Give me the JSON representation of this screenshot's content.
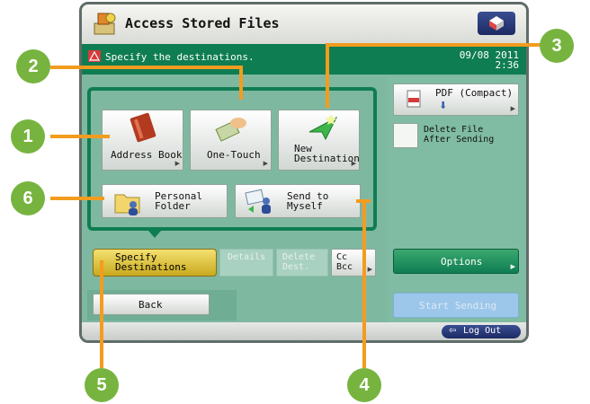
{
  "title": "Access Stored Files",
  "message": "Specify the destinations.",
  "date": "09/08 2011",
  "time": "2:36",
  "buttons": {
    "address_book": "Address Book",
    "one_touch": "One-Touch",
    "new_destination": "New\nDestination",
    "personal_folder": "Personal\nFolder",
    "send_to_myself": "Send to\nMyself",
    "specify_destinations": "Specify\nDestinations",
    "details": "Details",
    "delete_dest": "Delete\nDest.",
    "cc_bcc": "Cc\nBcc",
    "back": "Back",
    "pdf": "PDF (Compact)",
    "delete_file": "Delete File\nAfter Sending",
    "options": "Options",
    "start_sending": "Start Sending",
    "log_out": "Log Out"
  },
  "callouts": [
    "1",
    "2",
    "3",
    "4",
    "5",
    "6"
  ],
  "colors": {
    "accent": "#77b43f",
    "callout_line": "#f39c1f",
    "panel_green": "#0f7d52"
  }
}
